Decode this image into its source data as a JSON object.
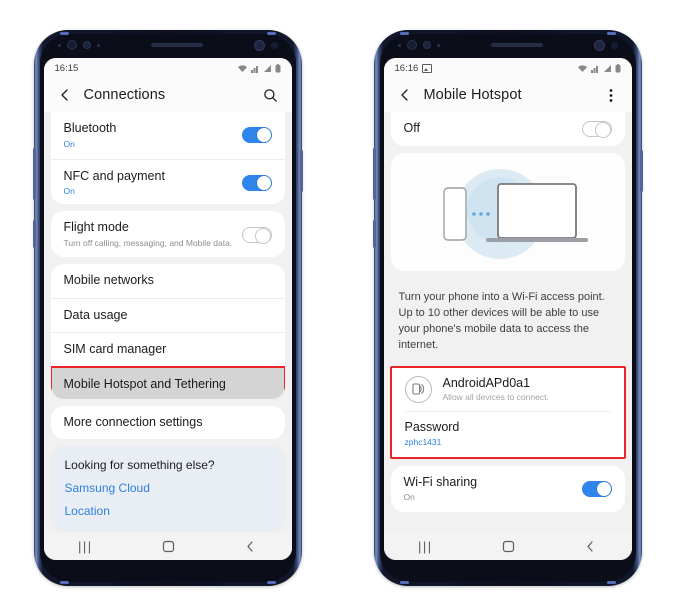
{
  "phones": [
    {
      "id": "connections-phone",
      "status_bar": {
        "time": "16:15",
        "icons": [
          "wifi-icon",
          "signal-icon",
          "signal-bars-icon",
          "battery-icon"
        ]
      },
      "appbar": {
        "back": "back-arrow-icon",
        "title": "Connections",
        "action": "search-icon"
      },
      "groups": [
        {
          "type": "card",
          "rows": [
            {
              "title": "Bluetooth",
              "sub": "On",
              "sub_style": "on",
              "toggle": "on"
            },
            {
              "title": "NFC and payment",
              "sub": "On",
              "sub_style": "on",
              "toggle": "on"
            }
          ]
        },
        {
          "type": "card",
          "rows": [
            {
              "title": "Flight mode",
              "sub": "Turn off calling, messaging, and Mobile data.",
              "sub_style": "muted",
              "toggle": "off"
            }
          ]
        },
        {
          "type": "card",
          "rows": [
            {
              "title": "Mobile networks",
              "sub": "",
              "toggle": "none"
            },
            {
              "title": "Data usage",
              "sub": "",
              "toggle": "none"
            },
            {
              "title": "SIM card manager",
              "sub": "",
              "toggle": "none"
            },
            {
              "title": "Mobile Hotspot and Tethering",
              "sub": "",
              "toggle": "none",
              "selected": true
            }
          ]
        },
        {
          "type": "card",
          "rows": [
            {
              "title": "More connection settings",
              "sub": "",
              "toggle": "none"
            }
          ]
        }
      ],
      "looking": {
        "title": "Looking for something else?",
        "links": [
          "Samsung Cloud",
          "Location"
        ]
      },
      "navbar": {
        "recents": "|||",
        "home": "home-icon",
        "back": "back-icon"
      }
    },
    {
      "id": "hotspot-phone",
      "status_bar": {
        "time": "16:16",
        "icons": [
          "image-icon",
          "wifi-icon",
          "signal-icon",
          "signal-bars-icon",
          "battery-icon"
        ]
      },
      "appbar": {
        "back": "back-arrow-icon",
        "title": "Mobile Hotspot",
        "action": "more-options-icon"
      },
      "master_toggle": {
        "label": "Off",
        "toggle": "off"
      },
      "hero": {
        "art": "phone-to-laptop-hotspot-illustration"
      },
      "description": "Turn your phone into a Wi-Fi access point. Up to 10 other devices will be able to use your phone's mobile data to access the internet.",
      "hotspot_box": {
        "icon": "hotspot-icon",
        "network_name": "AndroidAPd0a1",
        "network_sub": "Allow all devices to connect.",
        "password_label": "Password",
        "password_value": "zphc1431"
      },
      "wifi_sharing": {
        "title": "Wi-Fi sharing",
        "sub": "On",
        "toggle": "on"
      },
      "navbar": {
        "recents": "|||",
        "home": "home-icon",
        "back": "back-icon"
      }
    }
  ],
  "colors": {
    "accent_blue": "#2f85ec",
    "link_blue": "#2f7fe0",
    "highlight_red": "#e8242a",
    "screen_bg": "#f1f1f1",
    "card_white": "#ffffff"
  }
}
